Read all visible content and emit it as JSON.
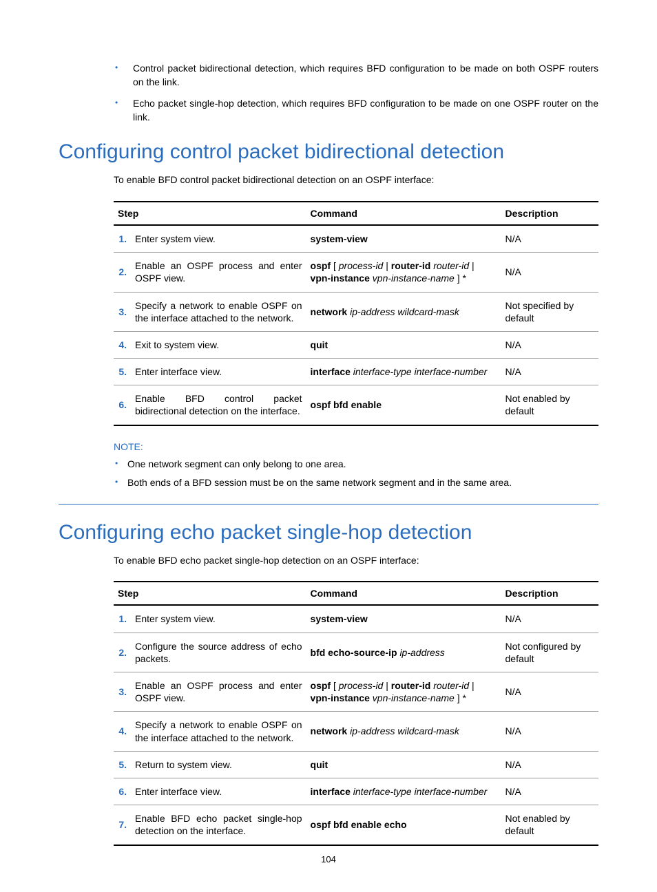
{
  "intro_bullets": [
    "Control packet bidirectional detection, which requires BFD configuration to be made on both OSPF routers on the link.",
    "Echo packet single-hop detection, which requires BFD configuration to be made on one OSPF router on the link."
  ],
  "section1": {
    "heading": "Configuring control packet bidirectional detection",
    "subtext": "To enable BFD control packet bidirectional detection on an OSPF interface:",
    "headers": {
      "step": "Step",
      "command": "Command",
      "description": "Description"
    },
    "rows": [
      {
        "num": "1.",
        "desc": "Enter system view.",
        "cmd": [
          {
            "b": true,
            "t": "system-view"
          }
        ],
        "dsc": "N/A"
      },
      {
        "num": "2.",
        "desc": "Enable an OSPF process and enter OSPF view.",
        "cmd": [
          {
            "b": true,
            "t": "ospf"
          },
          {
            "t": " [ "
          },
          {
            "i": true,
            "t": "process-id"
          },
          {
            "t": " | "
          },
          {
            "b": true,
            "t": "router-id"
          },
          {
            "t": " "
          },
          {
            "i": true,
            "t": "router-id"
          },
          {
            "t": " | "
          },
          {
            "b": true,
            "t": "vpn-instance"
          },
          {
            "t": " "
          },
          {
            "i": true,
            "t": "vpn-instance-name"
          },
          {
            "t": " ] *"
          }
        ],
        "dsc": "N/A"
      },
      {
        "num": "3.",
        "desc": "Specify a network to enable OSPF on the interface attached to the network.",
        "cmd": [
          {
            "b": true,
            "t": "network"
          },
          {
            "t": " "
          },
          {
            "i": true,
            "t": "ip-address wildcard-mask"
          }
        ],
        "dsc": "Not specified by default"
      },
      {
        "num": "4.",
        "desc": "Exit to system view.",
        "cmd": [
          {
            "b": true,
            "t": "quit"
          }
        ],
        "dsc": "N/A"
      },
      {
        "num": "5.",
        "desc": "Enter interface view.",
        "cmd": [
          {
            "b": true,
            "t": "interface"
          },
          {
            "t": " "
          },
          {
            "i": true,
            "t": "interface-type interface-number"
          }
        ],
        "dsc": "N/A"
      },
      {
        "num": "6.",
        "desc": "Enable BFD control packet bidirectional detection on the interface.",
        "cmd": [
          {
            "b": true,
            "t": "ospf bfd enable"
          }
        ],
        "dsc": "Not enabled by default"
      }
    ]
  },
  "note_label": "NOTE:",
  "notes": [
    "One network segment can only belong to one area.",
    "Both ends of a BFD session must be on the same network segment and in the same area."
  ],
  "section2": {
    "heading": "Configuring echo packet single-hop detection",
    "subtext": "To enable BFD echo packet single-hop detection on an OSPF interface:",
    "headers": {
      "step": "Step",
      "command": "Command",
      "description": "Description"
    },
    "rows": [
      {
        "num": "1.",
        "desc": "Enter system view.",
        "cmd": [
          {
            "b": true,
            "t": "system-view"
          }
        ],
        "dsc": "N/A"
      },
      {
        "num": "2.",
        "desc": "Configure the source address of echo packets.",
        "cmd": [
          {
            "b": true,
            "t": "bfd echo-source-ip"
          },
          {
            "t": " "
          },
          {
            "i": true,
            "t": "ip-address"
          }
        ],
        "dsc": "Not configured by default"
      },
      {
        "num": "3.",
        "desc": "Enable an OSPF process and enter OSPF view.",
        "cmd": [
          {
            "b": true,
            "t": "ospf"
          },
          {
            "t": " [ "
          },
          {
            "i": true,
            "t": "process-id"
          },
          {
            "t": " | "
          },
          {
            "b": true,
            "t": "router-id"
          },
          {
            "t": " "
          },
          {
            "i": true,
            "t": "router-id"
          },
          {
            "t": " | "
          },
          {
            "b": true,
            "t": "vpn-instance"
          },
          {
            "t": " "
          },
          {
            "i": true,
            "t": "vpn-instance-name"
          },
          {
            "t": " ] *"
          }
        ],
        "dsc": "N/A"
      },
      {
        "num": "4.",
        "desc": "Specify a network to enable OSPF on the interface attached to the network.",
        "cmd": [
          {
            "b": true,
            "t": "network"
          },
          {
            "t": " "
          },
          {
            "i": true,
            "t": "ip-address wildcard-mask"
          }
        ],
        "dsc": "N/A"
      },
      {
        "num": "5.",
        "desc": "Return to system view.",
        "cmd": [
          {
            "b": true,
            "t": "quit"
          }
        ],
        "dsc": "N/A"
      },
      {
        "num": "6.",
        "desc": "Enter interface view.",
        "cmd": [
          {
            "b": true,
            "t": "interface"
          },
          {
            "t": " "
          },
          {
            "i": true,
            "t": "interface-type interface-number"
          }
        ],
        "dsc": "N/A"
      },
      {
        "num": "7.",
        "desc": "Enable BFD echo packet single-hop detection on the interface.",
        "cmd": [
          {
            "b": true,
            "t": "ospf bfd enable echo"
          }
        ],
        "dsc": "Not enabled by default"
      }
    ]
  },
  "page_number": "104"
}
